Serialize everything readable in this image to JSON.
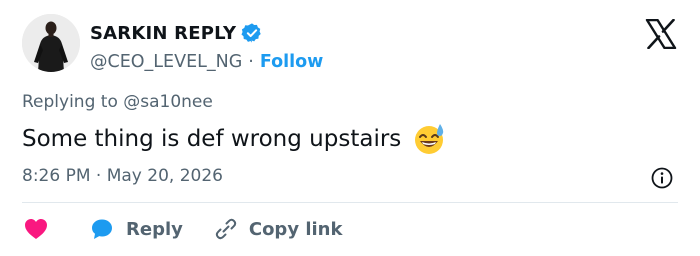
{
  "author": {
    "display_name": "SARKIN REPLY",
    "handle": "@CEO_LEVEL_NG",
    "separator": "·",
    "follow_label": "Follow",
    "verified_color": "#1d9bf0"
  },
  "reply_context": "Replying to @sa10nee",
  "tweet": {
    "text": "Some thing is def wrong upstairs",
    "emoji": "grinning-face-with-sweat"
  },
  "timestamp": "8:26 PM · May 20, 2026",
  "actions": {
    "reply_label": "Reply",
    "copy_label": "Copy link"
  },
  "colors": {
    "accent": "#1d9bf0",
    "heart": "#f91880",
    "muted": "#536471"
  }
}
